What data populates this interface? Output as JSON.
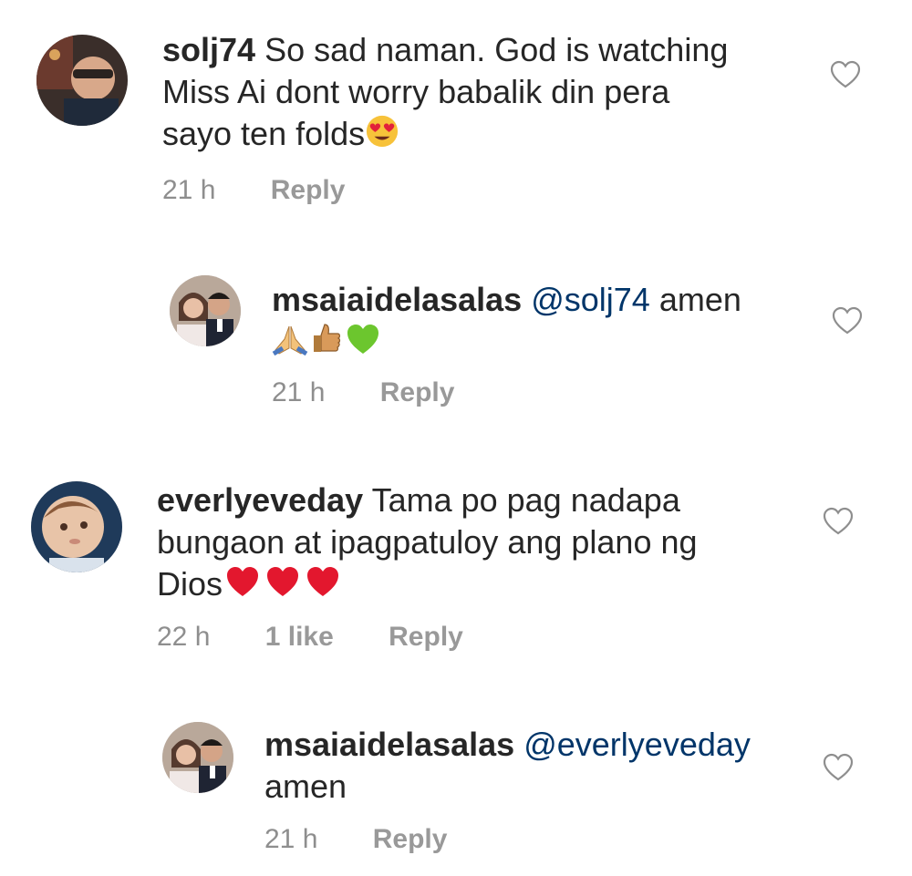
{
  "comments": [
    {
      "username": "solj74",
      "text_line1": "So sad naman. God is watching",
      "text_line2": "Miss Ai dont worry babalik din pera",
      "text_line3": "sayo ten folds",
      "time": "21 h",
      "reply_label": "Reply",
      "emoji": "heart-eyes-emoji"
    },
    {
      "username": "msaiaidelasalas",
      "mention": "@solj74",
      "text": "amen",
      "time": "21 h",
      "reply_label": "Reply",
      "emojis": [
        "folded-hands-emoji",
        "thumbs-up-emoji",
        "green-heart-emoji"
      ]
    },
    {
      "username": "everlyeveday",
      "text_line1": "Tama po pag nadapa",
      "text_line2": "bungaon at ipagpatuloy ang plano ng",
      "text_line3": "Dios",
      "time": "22 h",
      "likes": "1 like",
      "reply_label": "Reply",
      "emojis": [
        "red-heart-emoji",
        "red-heart-emoji",
        "red-heart-emoji"
      ]
    },
    {
      "username": "msaiaidelasalas",
      "mention": "@everlyeveday",
      "text": "amen",
      "time": "21 h",
      "reply_label": "Reply"
    }
  ],
  "colors": {
    "text": "#262626",
    "meta": "#8e8e8e",
    "mention": "#003569",
    "heart_outline": "#8e8e8e"
  }
}
